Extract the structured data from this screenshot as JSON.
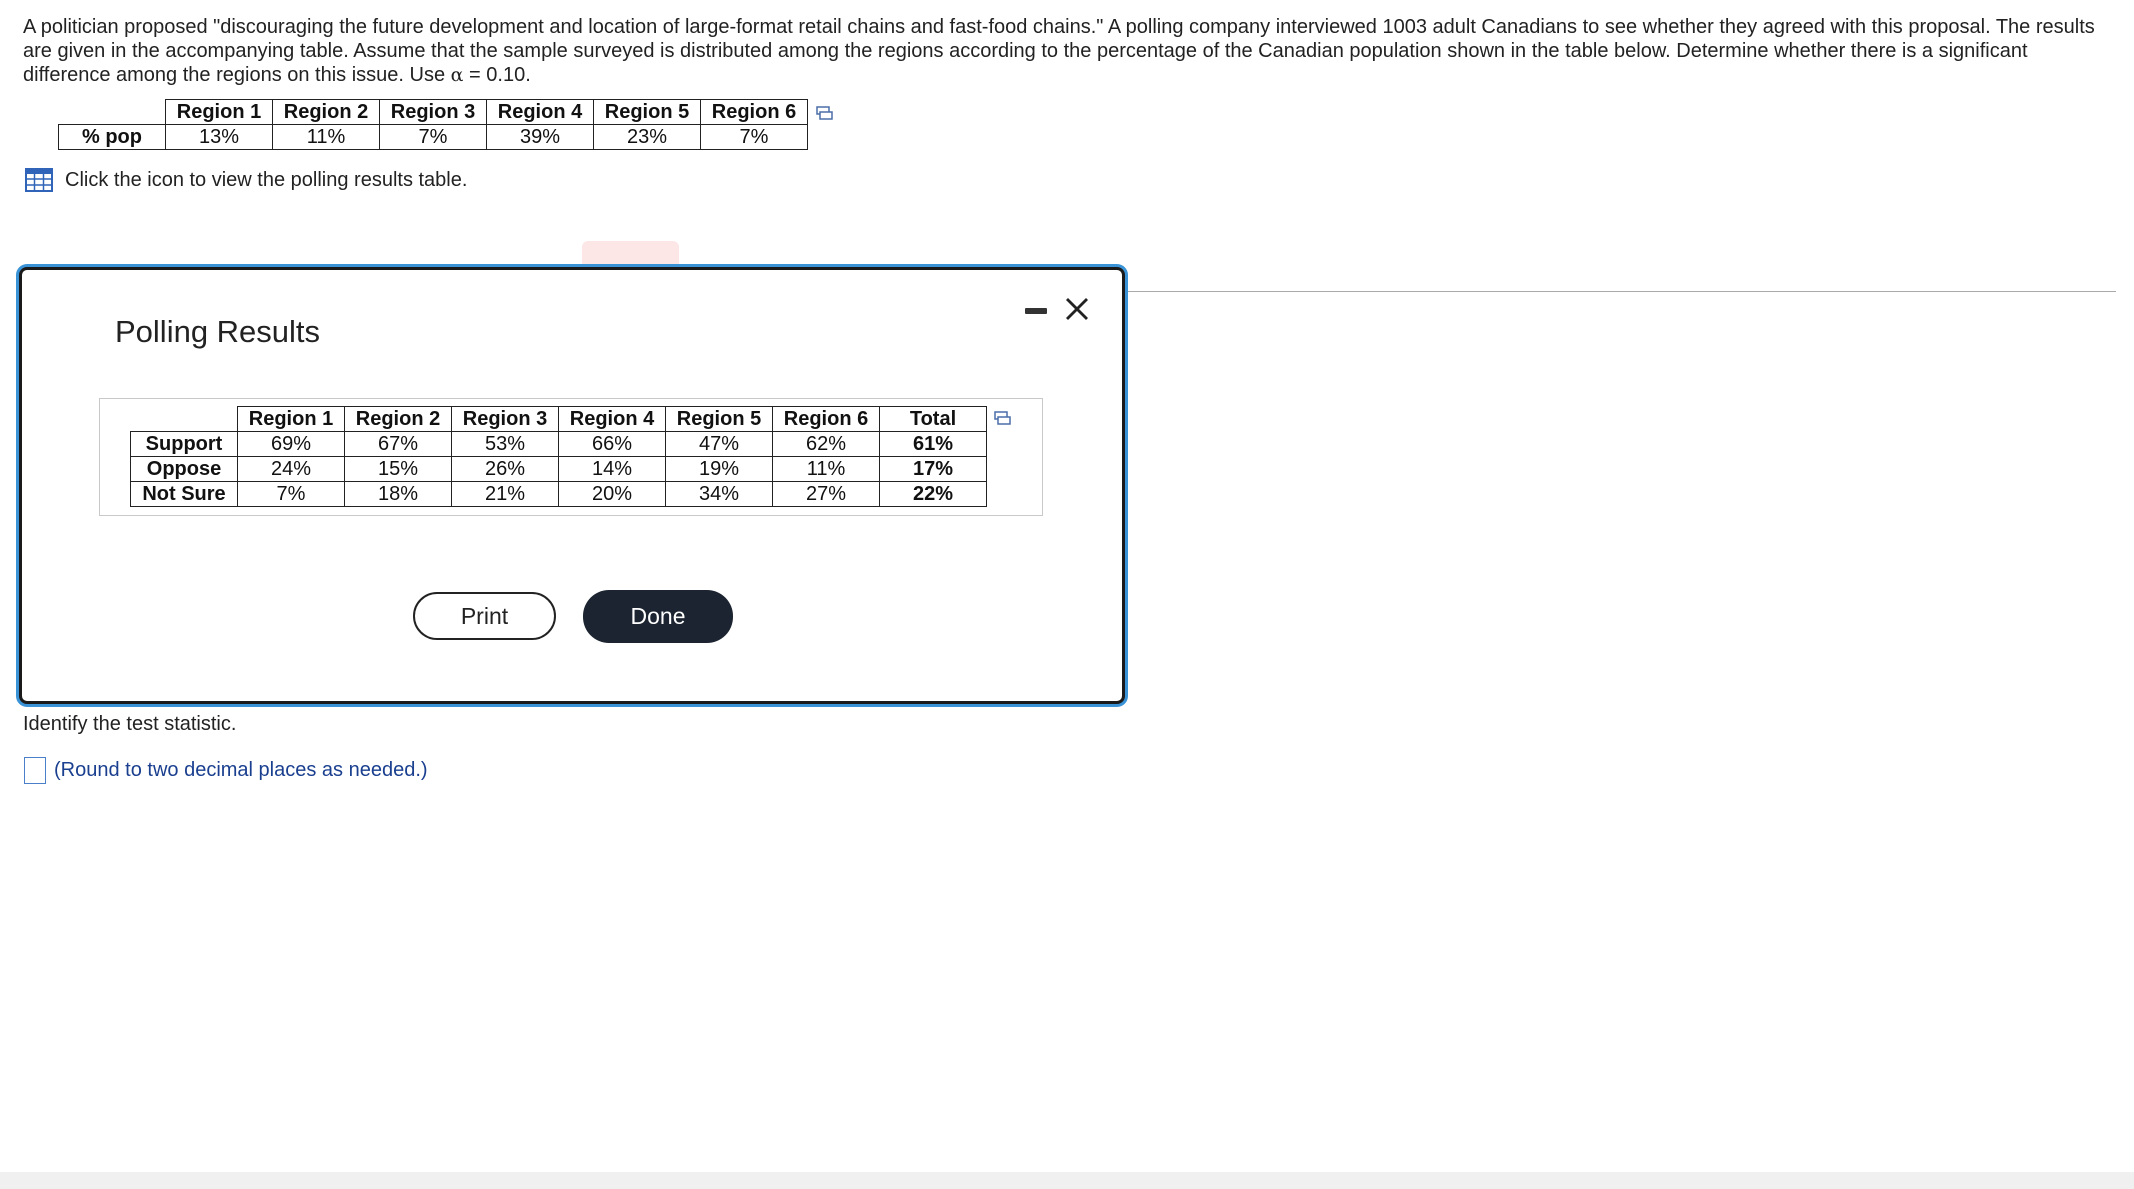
{
  "problem": {
    "text_before_alpha": "A politician proposed \"discouraging the future development and location of large-format retail chains and fast-food chains.\" A polling company interviewed 1003 adult Canadians to see whether they agreed with this proposal. The results are given in the accompanying table. Assume that the sample surveyed is distributed among the regions according to the percentage of the Canadian population shown in the table below. Determine whether there is a significant difference among the regions on this issue. Use ",
    "alpha_symbol": "α",
    "alpha_value": " = 0.10."
  },
  "population_table": {
    "headers": [
      "Region 1",
      "Region 2",
      "Region 3",
      "Region 4",
      "Region 5",
      "Region 6"
    ],
    "row_label": "% pop",
    "values": [
      "13%",
      "11%",
      "7%",
      "39%",
      "23%",
      "7%"
    ]
  },
  "results_link_text": "Click the icon to view the polling results table.",
  "modal": {
    "title": "Polling Results",
    "table": {
      "headers": [
        "Region 1",
        "Region 2",
        "Region 3",
        "Region 4",
        "Region 5",
        "Region 6",
        "Total"
      ],
      "rows": [
        {
          "label": "Support",
          "values": [
            "69%",
            "67%",
            "53%",
            "66%",
            "47%",
            "62%"
          ],
          "total": "61%"
        },
        {
          "label": "Oppose",
          "values": [
            "24%",
            "15%",
            "26%",
            "14%",
            "19%",
            "11%"
          ],
          "total": "17%"
        },
        {
          "label": "Not Sure",
          "values": [
            "7%",
            "18%",
            "21%",
            "20%",
            "34%",
            "27%"
          ],
          "total": "22%"
        }
      ]
    },
    "print_label": "Print",
    "done_label": "Done"
  },
  "question": {
    "prompt": "Identify the test statistic.",
    "hint": "(Round to two decimal places as needed.)"
  }
}
